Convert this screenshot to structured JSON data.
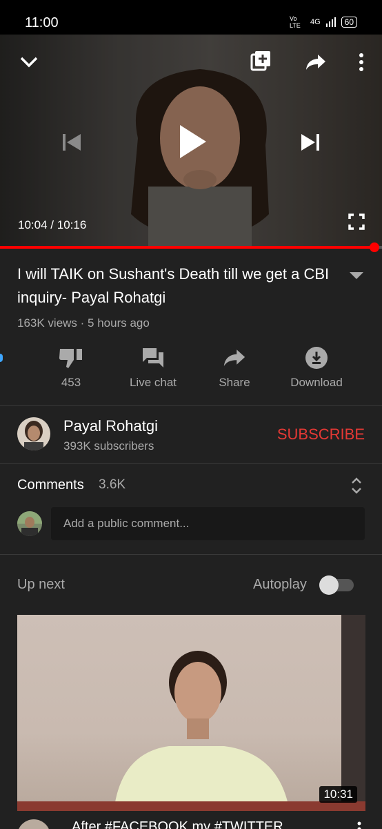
{
  "status_bar": {
    "time": "11:00",
    "network": "Vo LTE",
    "signal": "4G",
    "battery": "60"
  },
  "player": {
    "time_current": "10:04",
    "time_separator": "/",
    "time_total": "10:16",
    "progress": 0.981
  },
  "video": {
    "title": "I will TAIK on Sushant's Death till we get a CBI inquiry- Payal Rohatgi",
    "meta": "163K views · 5 hours ago"
  },
  "actions": {
    "dislike_count": "453",
    "live_chat": "Live chat",
    "share": "Share",
    "download": "Download"
  },
  "channel": {
    "name": "Payal Rohatgi",
    "subscribers": "393K subscribers",
    "subscribe_label": "SUBSCRIBE",
    "subscribe_color": "#e53935"
  },
  "comments": {
    "label": "Comments",
    "count": "3.6K",
    "placeholder": "Add a public comment..."
  },
  "up_next": {
    "label": "Up next",
    "autoplay_label": "Autoplay",
    "autoplay_on": false,
    "duration": "10:31",
    "next_title": "After #FACEBOOK my #TWITTER"
  },
  "colors": {
    "background": "#212121",
    "accent": "#ff0000",
    "muted_text": "#aaaaaa"
  }
}
